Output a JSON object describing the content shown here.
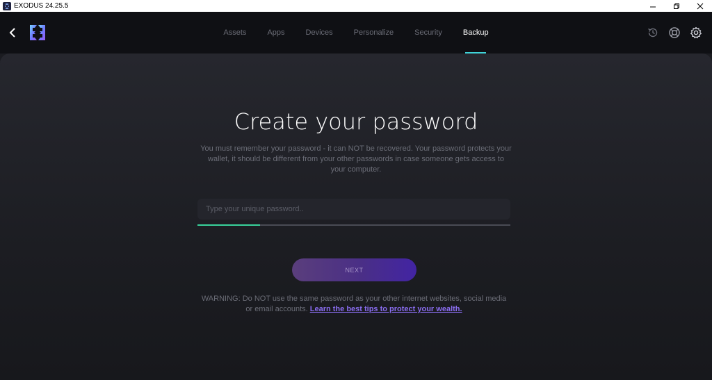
{
  "window": {
    "title": "EXODUS 24.25.5",
    "controls": [
      "minimize-icon",
      "restore-icon",
      "close-icon"
    ]
  },
  "header": {
    "back_icon": "chevron-left-icon",
    "logo_icon": "exodus-logo-icon",
    "tabs": [
      {
        "label": "Assets",
        "active": false
      },
      {
        "label": "Apps",
        "active": false
      },
      {
        "label": "Devices",
        "active": false
      },
      {
        "label": "Personalize",
        "active": false
      },
      {
        "label": "Security",
        "active": false
      },
      {
        "label": "Backup",
        "active": true
      }
    ],
    "right_icons": [
      "history-icon",
      "support-icon",
      "settings-icon"
    ]
  },
  "main": {
    "heading": "Create your password",
    "description": "You must remember your password - it can NOT be recovered. Your password protects your wallet, it should be different from your other passwords in case someone gets access to your computer.",
    "password": {
      "value": "",
      "placeholder": "Type your unique password..",
      "strength_fraction": 0.2
    },
    "next_label": "NEXT",
    "warning_text": "WARNING: Do NOT use the same password as your other internet websites, social media or email accounts.",
    "warning_link": "Learn the best tips to protect your wealth."
  },
  "colors": {
    "accent_tab_underline": "#3fd3d8",
    "strength_bar": "#39d39c",
    "link": "#8a6df0",
    "button_gradient_start": "#5a3e7c",
    "button_gradient_end": "#4224a3"
  }
}
